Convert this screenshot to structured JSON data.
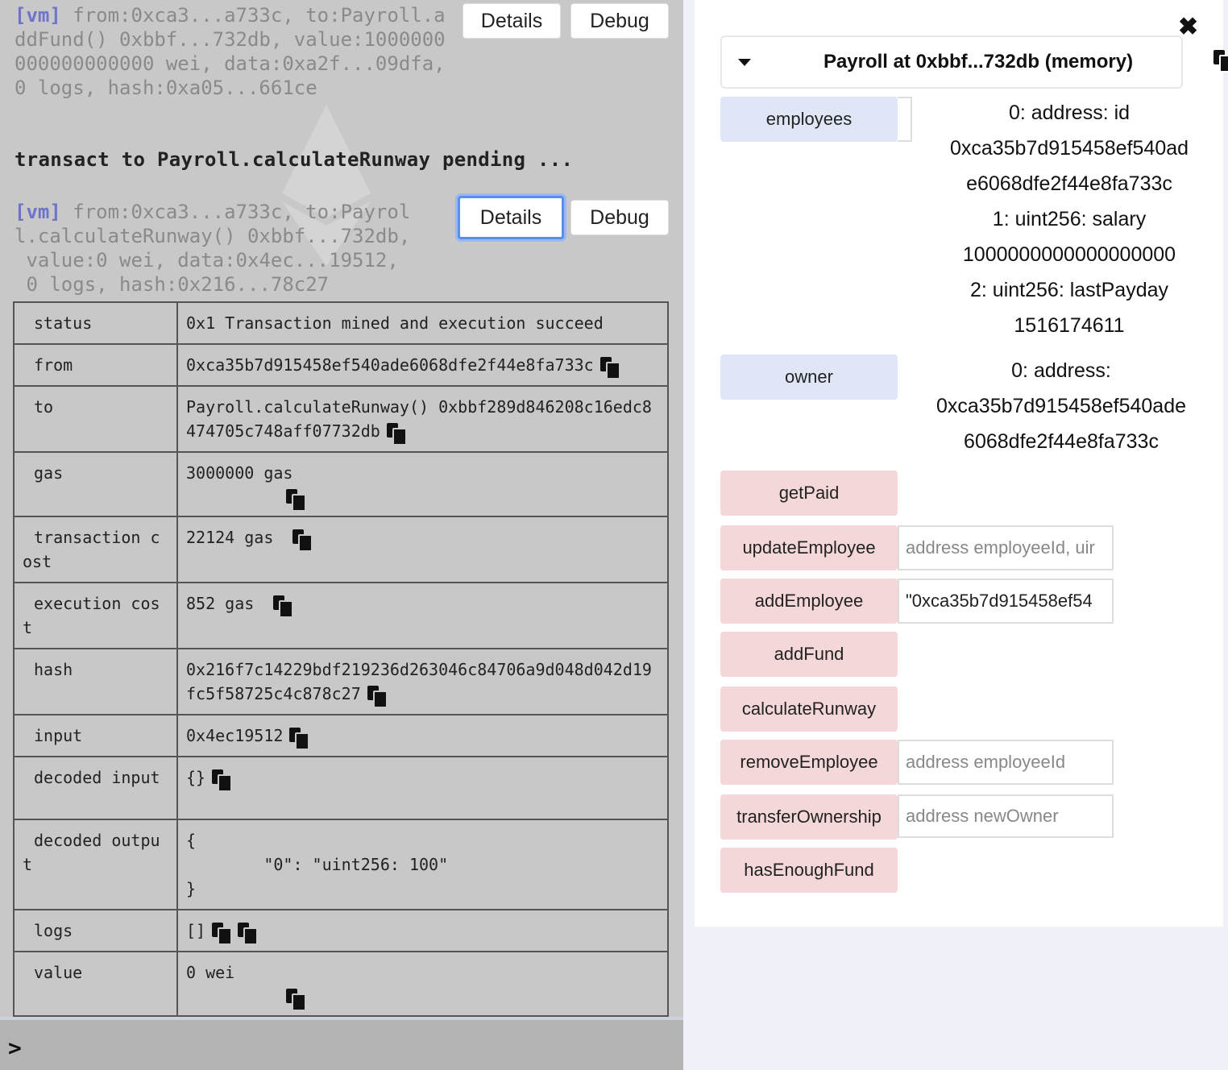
{
  "terminal": {
    "log1": {
      "tag": "[vm]",
      "text": " from:0xca3...a733c, to:Payroll.addFund() 0xbbf...732db, value:1000000000000000000 wei, data:0xa2f...09dfa, 0 logs, hash:0xa05...661ce",
      "details_label": "Details",
      "debug_label": "Debug"
    },
    "pending": "transact to Payroll.calculateRunway pending ...",
    "log2": {
      "tag": "[vm]",
      "line1": " from:0xca3...a733c, to:Payrol",
      "line2": "l.calculateRunway() 0xbbf...732db,",
      "line3": " value:0 wei, data:0x4ec...19512,",
      "line4": " 0 logs, hash:0x216...78c27",
      "details_label": "Details",
      "debug_label": "Debug"
    },
    "tx_table": [
      {
        "key": "status",
        "value": "0x1 Transaction mined and execution succeed"
      },
      {
        "key": "from",
        "value": "0xca35b7d915458ef540ade6068dfe2f44e8fa733c"
      },
      {
        "key": "to",
        "value": "Payroll.calculateRunway() 0xbbf289d846208c16edc8474705c748aff07732db"
      },
      {
        "key": "gas",
        "value": "3000000 gas"
      },
      {
        "key": "transaction cost",
        "value": "22124 gas"
      },
      {
        "key": "execution cost",
        "value": "852 gas"
      },
      {
        "key": "hash",
        "value": "0x216f7c14229bdf219236d263046c84706a9d048d042d19fc5f58725c4c878c27"
      },
      {
        "key": "input",
        "value": "0x4ec19512"
      },
      {
        "key": "decoded input",
        "value": "{}"
      },
      {
        "key": "decoded output",
        "value_lines": [
          "{",
          "        \"0\": \"uint256: 100\"",
          "}"
        ]
      },
      {
        "key": "logs",
        "value": "[]"
      },
      {
        "key": "value",
        "value": "0 wei"
      }
    ],
    "prompt": ">"
  },
  "panel": {
    "instance_title": "Payroll at 0xbbf...732db (memory)",
    "functions": {
      "employees": "employees",
      "owner": "owner",
      "getPaid": "getPaid",
      "updateEmployee": "updateEmployee",
      "addEmployee": "addEmployee",
      "addFund": "addFund",
      "calculateRunway": "calculateRunway",
      "removeEmployee": "removeEmployee",
      "transferOwnership": "transferOwnership",
      "hasEnoughFund": "hasEnoughFund"
    },
    "inputs": {
      "updateEmployee_placeholder": "address employeeId, uir",
      "addEmployee_value": "\"0xca35b7d915458ef54",
      "removeEmployee_placeholder": "address employeeId",
      "transferOwnership_placeholder": "address newOwner"
    },
    "employees_result": [
      "0: address: id",
      "0xca35b7d915458ef540ad",
      "e6068dfe2f44e8fa733c",
      "1: uint256: salary",
      "1000000000000000000",
      "2: uint256: lastPayday",
      "1516174611"
    ],
    "owner_result": [
      "0: address:",
      "0xca35b7d915458ef540ade",
      "6068dfe2f44e8fa733c"
    ]
  }
}
